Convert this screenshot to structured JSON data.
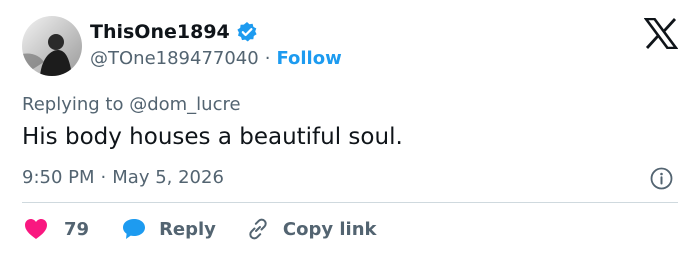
{
  "author": {
    "display_name": "ThisOne1894",
    "handle": "@TOne189477040",
    "separator": "·",
    "follow_label": "Follow",
    "verified_icon": "verified-badge-icon",
    "avatar": "avatar-photo"
  },
  "replying_to": "Replying to @dom_lucre",
  "tweet": {
    "text": "His body houses a beautiful soul.",
    "time": "9:50 PM",
    "separator": "·",
    "date": "May 5, 2026"
  },
  "actions": {
    "like_count": "79",
    "reply_label": "Reply",
    "copy_link_label": "Copy link"
  },
  "icons": {
    "logo": "x-logo-icon",
    "info": "info-icon",
    "like": "heart-icon",
    "reply": "speech-bubble-icon",
    "copy": "link-icon"
  },
  "colors": {
    "text": "#0f1419",
    "secondary": "#536471",
    "accent": "#1d9bf0",
    "like": "#f91880",
    "divider": "#cfd9de"
  }
}
